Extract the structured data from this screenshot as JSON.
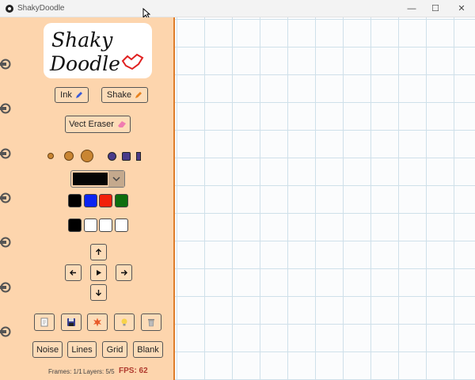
{
  "window": {
    "title": "ShakyDoodle",
    "minimize_glyph": "—",
    "maximize_glyph": "☐",
    "close_glyph": "✕"
  },
  "logo": {
    "line1": "Shaky",
    "line2": "Doodle",
    "colors": {
      "ink": "#111111",
      "accent": "#e02020"
    }
  },
  "toolbar": {
    "ink_label": "Ink",
    "shake_label": "Shake",
    "vect_eraser_label": "Vect Eraser"
  },
  "brush_sizes": [
    "small-circle",
    "medium-circle",
    "large-circle"
  ],
  "brush_shapes": [
    "circle",
    "square",
    "rectangle"
  ],
  "current_color": "#050505",
  "palette": [
    "#000000",
    "#0a24f2",
    "#f21f0a",
    "#0e6e0e"
  ],
  "recent_colors": [
    "#000000",
    "#ffffff",
    "#ffffff",
    "#ffffff"
  ],
  "navigation": {
    "up_icon": "arrow-up",
    "left_icon": "arrow-left",
    "play_icon": "play",
    "right_icon": "arrow-right",
    "down_icon": "arrow-down"
  },
  "tools": [
    "new-page-icon",
    "save-icon",
    "burst-icon",
    "lightbulb-icon",
    "trash-icon"
  ],
  "backgrounds": {
    "noise_label": "Noise",
    "lines_label": "Lines",
    "grid_label": "Grid",
    "blank_label": "Blank"
  },
  "status": {
    "frames": "Frames: 1/1",
    "layers": "Layers: 5/5",
    "fps": "FPS: 62"
  },
  "colors": {
    "sidebar": "#fdd5ad",
    "accent": "#e07d2a",
    "grid_line": "#cfe0ea",
    "brush_orange": "#c98532",
    "brush_purple": "#4a3b8a"
  }
}
